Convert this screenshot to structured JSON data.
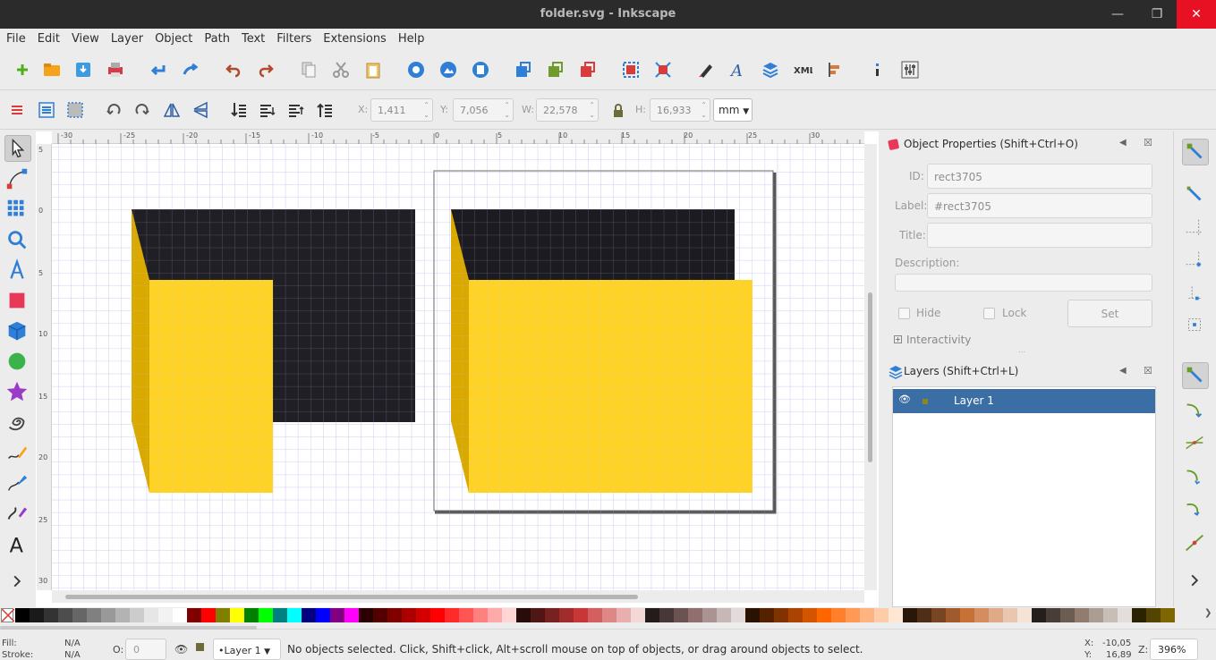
{
  "window": {
    "title": "folder.svg - Inkscape"
  },
  "menu": [
    "File",
    "Edit",
    "View",
    "Layer",
    "Object",
    "Path",
    "Text",
    "Filters",
    "Extensions",
    "Help"
  ],
  "transform": {
    "x_label": "X:",
    "x_value": "1,411",
    "y_label": "Y:",
    "y_value": "7,056",
    "w_label": "W:",
    "w_value": "22,578",
    "h_label": "H:",
    "h_value": "16,933",
    "unit": "mm"
  },
  "ruler": {
    "h_ticks": [
      "-30",
      "-25",
      "-20",
      "-15",
      "-10",
      "-5",
      "0",
      "5",
      "10",
      "15",
      "20",
      "25",
      "30"
    ],
    "v_ticks": [
      "5",
      "0",
      "5",
      "10",
      "15",
      "20",
      "25",
      "30"
    ]
  },
  "object_properties": {
    "title": "Object Properties (Shift+Ctrl+O)",
    "id_label": "ID:",
    "id_value": "rect3705",
    "label_label": "Label:",
    "label_value": "#rect3705",
    "title_label": "Title:",
    "title_value": "",
    "description_label": "Description:",
    "hide_label": "Hide",
    "lock_label": "Lock",
    "set_label": "Set",
    "interactivity_label": "Interactivity"
  },
  "layers_panel": {
    "title": "Layers (Shift+Ctrl+L)",
    "items": [
      {
        "label": "Layer 1"
      }
    ]
  },
  "status": {
    "fill_label": "Fill:",
    "fill_value": "N/A",
    "stroke_label": "Stroke:",
    "stroke_value": "N/A",
    "opacity_label": "O:",
    "opacity_value": "0",
    "layer": "•Layer 1",
    "message": "No objects selected. Click, Shift+click, Alt+scroll mouse on top of objects, or drag around objects to select.",
    "x_label": "X:",
    "x_value": "-10,05",
    "y_label": "Y:",
    "y_value": "16,89",
    "zoom_label": "Z:",
    "zoom_value": "396%"
  },
  "colors": {
    "folder_yellow": "#ffd326",
    "folder_dark_yellow": "#d9a900",
    "folder_black": "#1c1b21",
    "selection_blue": "#3b6ea5",
    "close_red": "#e81123"
  }
}
